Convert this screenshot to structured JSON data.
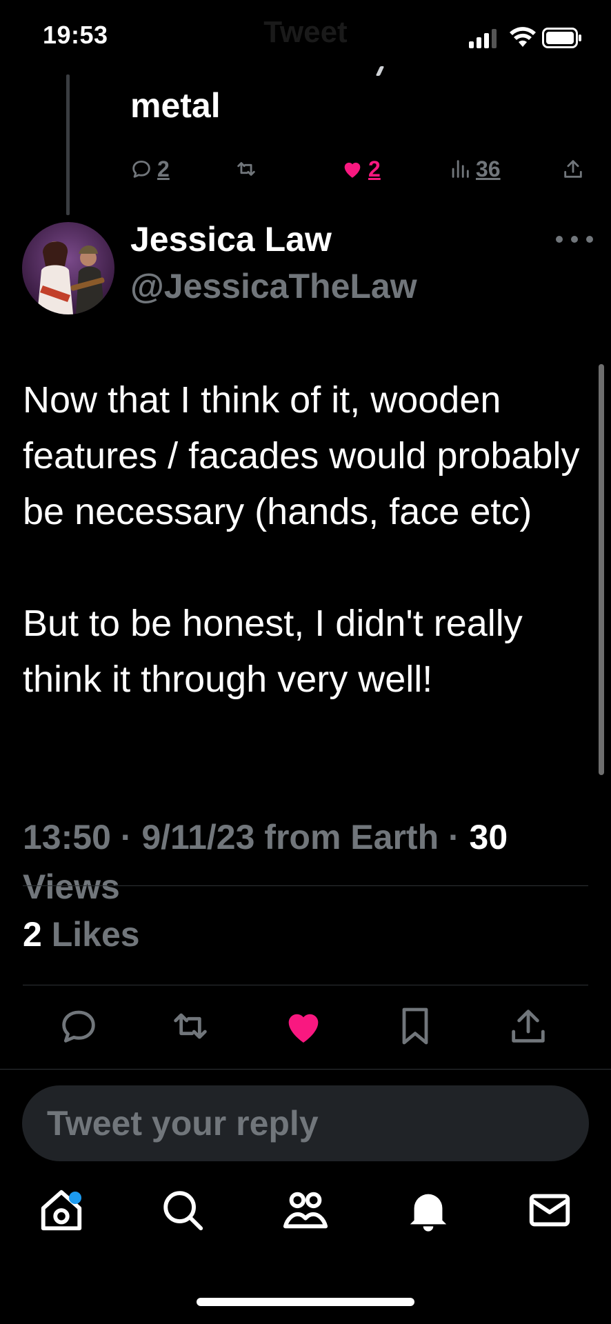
{
  "status_bar": {
    "time": "19:53",
    "screen_title": "Tweet"
  },
  "previous_tweet": {
    "text_tail": "metal",
    "replies": "2",
    "likes": "2",
    "views": "36",
    "liked": true
  },
  "tweet": {
    "author_name": "Jessica Law",
    "author_handle": "@JessicaTheLaw",
    "paragraphs": [
      "Now that I think of it, wooden features / facades would probably be necessary (hands, face etc)",
      "But to be honest, I didn't really think it through very well!"
    ],
    "time": "13:50",
    "date": "9/11/23",
    "source": "from Earth",
    "views_count": "30",
    "views_label": "Views",
    "likes_count": "2",
    "likes_label": "Likes",
    "liked": true
  },
  "reply": {
    "placeholder": "Tweet your reply"
  },
  "icons": {
    "reply": "reply-icon",
    "retweet": "retweet-icon",
    "like": "heart-icon",
    "views": "views-icon",
    "share": "share-icon",
    "bookmark": "bookmark-icon",
    "more": "more-icon",
    "home": "home-icon",
    "search": "search-icon",
    "communities": "communities-icon",
    "notifications": "bell-icon",
    "messages": "mail-icon"
  },
  "colors": {
    "background": "#000000",
    "text_primary": "#ffffff",
    "text_secondary": "#71767b",
    "like_pink": "#f91880",
    "accent_blue": "#1d9bf0",
    "input_bg": "#202327"
  }
}
